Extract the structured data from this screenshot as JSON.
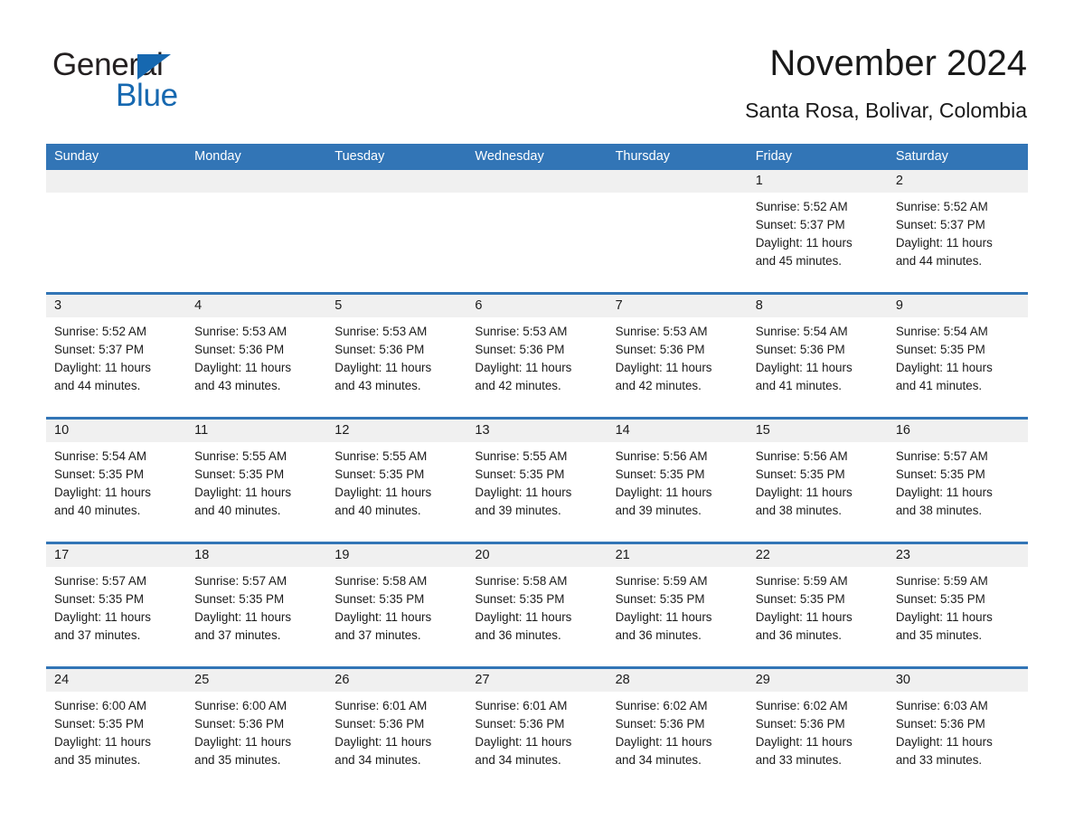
{
  "brand": {
    "name_part1": "General",
    "name_part2": "Blue",
    "accent_color": "#1668b0"
  },
  "header": {
    "month_title": "November 2024",
    "location": "Santa Rosa, Bolivar, Colombia"
  },
  "calendar": {
    "header_color": "#3275b6",
    "daynum_band_color": "#f0f0f0",
    "weekday_headers": [
      "Sunday",
      "Monday",
      "Tuesday",
      "Wednesday",
      "Thursday",
      "Friday",
      "Saturday"
    ],
    "weeks": [
      [
        {
          "day": "",
          "lines": []
        },
        {
          "day": "",
          "lines": []
        },
        {
          "day": "",
          "lines": []
        },
        {
          "day": "",
          "lines": []
        },
        {
          "day": "",
          "lines": []
        },
        {
          "day": "1",
          "lines": [
            "Sunrise: 5:52 AM",
            "Sunset: 5:37 PM",
            "Daylight: 11 hours",
            "and 45 minutes."
          ]
        },
        {
          "day": "2",
          "lines": [
            "Sunrise: 5:52 AM",
            "Sunset: 5:37 PM",
            "Daylight: 11 hours",
            "and 44 minutes."
          ]
        }
      ],
      [
        {
          "day": "3",
          "lines": [
            "Sunrise: 5:52 AM",
            "Sunset: 5:37 PM",
            "Daylight: 11 hours",
            "and 44 minutes."
          ]
        },
        {
          "day": "4",
          "lines": [
            "Sunrise: 5:53 AM",
            "Sunset: 5:36 PM",
            "Daylight: 11 hours",
            "and 43 minutes."
          ]
        },
        {
          "day": "5",
          "lines": [
            "Sunrise: 5:53 AM",
            "Sunset: 5:36 PM",
            "Daylight: 11 hours",
            "and 43 minutes."
          ]
        },
        {
          "day": "6",
          "lines": [
            "Sunrise: 5:53 AM",
            "Sunset: 5:36 PM",
            "Daylight: 11 hours",
            "and 42 minutes."
          ]
        },
        {
          "day": "7",
          "lines": [
            "Sunrise: 5:53 AM",
            "Sunset: 5:36 PM",
            "Daylight: 11 hours",
            "and 42 minutes."
          ]
        },
        {
          "day": "8",
          "lines": [
            "Sunrise: 5:54 AM",
            "Sunset: 5:36 PM",
            "Daylight: 11 hours",
            "and 41 minutes."
          ]
        },
        {
          "day": "9",
          "lines": [
            "Sunrise: 5:54 AM",
            "Sunset: 5:35 PM",
            "Daylight: 11 hours",
            "and 41 minutes."
          ]
        }
      ],
      [
        {
          "day": "10",
          "lines": [
            "Sunrise: 5:54 AM",
            "Sunset: 5:35 PM",
            "Daylight: 11 hours",
            "and 40 minutes."
          ]
        },
        {
          "day": "11",
          "lines": [
            "Sunrise: 5:55 AM",
            "Sunset: 5:35 PM",
            "Daylight: 11 hours",
            "and 40 minutes."
          ]
        },
        {
          "day": "12",
          "lines": [
            "Sunrise: 5:55 AM",
            "Sunset: 5:35 PM",
            "Daylight: 11 hours",
            "and 40 minutes."
          ]
        },
        {
          "day": "13",
          "lines": [
            "Sunrise: 5:55 AM",
            "Sunset: 5:35 PM",
            "Daylight: 11 hours",
            "and 39 minutes."
          ]
        },
        {
          "day": "14",
          "lines": [
            "Sunrise: 5:56 AM",
            "Sunset: 5:35 PM",
            "Daylight: 11 hours",
            "and 39 minutes."
          ]
        },
        {
          "day": "15",
          "lines": [
            "Sunrise: 5:56 AM",
            "Sunset: 5:35 PM",
            "Daylight: 11 hours",
            "and 38 minutes."
          ]
        },
        {
          "day": "16",
          "lines": [
            "Sunrise: 5:57 AM",
            "Sunset: 5:35 PM",
            "Daylight: 11 hours",
            "and 38 minutes."
          ]
        }
      ],
      [
        {
          "day": "17",
          "lines": [
            "Sunrise: 5:57 AM",
            "Sunset: 5:35 PM",
            "Daylight: 11 hours",
            "and 37 minutes."
          ]
        },
        {
          "day": "18",
          "lines": [
            "Sunrise: 5:57 AM",
            "Sunset: 5:35 PM",
            "Daylight: 11 hours",
            "and 37 minutes."
          ]
        },
        {
          "day": "19",
          "lines": [
            "Sunrise: 5:58 AM",
            "Sunset: 5:35 PM",
            "Daylight: 11 hours",
            "and 37 minutes."
          ]
        },
        {
          "day": "20",
          "lines": [
            "Sunrise: 5:58 AM",
            "Sunset: 5:35 PM",
            "Daylight: 11 hours",
            "and 36 minutes."
          ]
        },
        {
          "day": "21",
          "lines": [
            "Sunrise: 5:59 AM",
            "Sunset: 5:35 PM",
            "Daylight: 11 hours",
            "and 36 minutes."
          ]
        },
        {
          "day": "22",
          "lines": [
            "Sunrise: 5:59 AM",
            "Sunset: 5:35 PM",
            "Daylight: 11 hours",
            "and 36 minutes."
          ]
        },
        {
          "day": "23",
          "lines": [
            "Sunrise: 5:59 AM",
            "Sunset: 5:35 PM",
            "Daylight: 11 hours",
            "and 35 minutes."
          ]
        }
      ],
      [
        {
          "day": "24",
          "lines": [
            "Sunrise: 6:00 AM",
            "Sunset: 5:35 PM",
            "Daylight: 11 hours",
            "and 35 minutes."
          ]
        },
        {
          "day": "25",
          "lines": [
            "Sunrise: 6:00 AM",
            "Sunset: 5:36 PM",
            "Daylight: 11 hours",
            "and 35 minutes."
          ]
        },
        {
          "day": "26",
          "lines": [
            "Sunrise: 6:01 AM",
            "Sunset: 5:36 PM",
            "Daylight: 11 hours",
            "and 34 minutes."
          ]
        },
        {
          "day": "27",
          "lines": [
            "Sunrise: 6:01 AM",
            "Sunset: 5:36 PM",
            "Daylight: 11 hours",
            "and 34 minutes."
          ]
        },
        {
          "day": "28",
          "lines": [
            "Sunrise: 6:02 AM",
            "Sunset: 5:36 PM",
            "Daylight: 11 hours",
            "and 34 minutes."
          ]
        },
        {
          "day": "29",
          "lines": [
            "Sunrise: 6:02 AM",
            "Sunset: 5:36 PM",
            "Daylight: 11 hours",
            "and 33 minutes."
          ]
        },
        {
          "day": "30",
          "lines": [
            "Sunrise: 6:03 AM",
            "Sunset: 5:36 PM",
            "Daylight: 11 hours",
            "and 33 minutes."
          ]
        }
      ]
    ]
  }
}
